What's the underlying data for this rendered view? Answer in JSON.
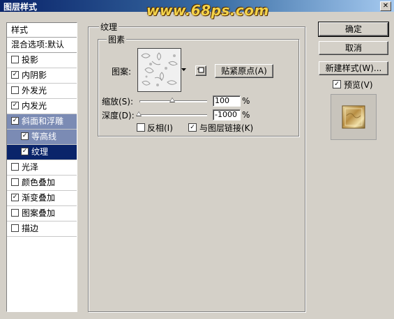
{
  "window": {
    "title": "图层样式",
    "watermark": "www.68ps.com",
    "close": "✕"
  },
  "styles_panel": {
    "header": "样式",
    "blend_options": "混合选项:默认",
    "items": [
      {
        "label": "投影",
        "checked": false
      },
      {
        "label": "内阴影",
        "checked": true
      },
      {
        "label": "外发光",
        "checked": false
      },
      {
        "label": "内发光",
        "checked": true
      },
      {
        "label": "斜面和浮雕",
        "checked": true
      },
      {
        "label": "等高线",
        "checked": true
      },
      {
        "label": "纹理",
        "checked": true
      },
      {
        "label": "光泽",
        "checked": false
      },
      {
        "label": "颜色叠加",
        "checked": false
      },
      {
        "label": "渐变叠加",
        "checked": true
      },
      {
        "label": "图案叠加",
        "checked": false
      },
      {
        "label": "描边",
        "checked": false
      }
    ]
  },
  "texture": {
    "group_title": "纹理",
    "pattern_group_title": "图素",
    "pattern_label": "图案:",
    "snap_button": "贴紧原点(A)",
    "scale_label": "缩放(S):",
    "scale_value": "100",
    "scale_unit": "%",
    "depth_label": "深度(D):",
    "depth_value": "-1000",
    "depth_unit": "%",
    "invert_label": "反相(I)",
    "invert_checked": false,
    "link_label": "与图层链接(K)",
    "link_checked": true
  },
  "buttons": {
    "ok": "确定",
    "cancel": "取消",
    "new_style": "新建样式(W)...",
    "preview_label": "预览(V)",
    "preview_checked": true
  },
  "check_glyph": "✓"
}
